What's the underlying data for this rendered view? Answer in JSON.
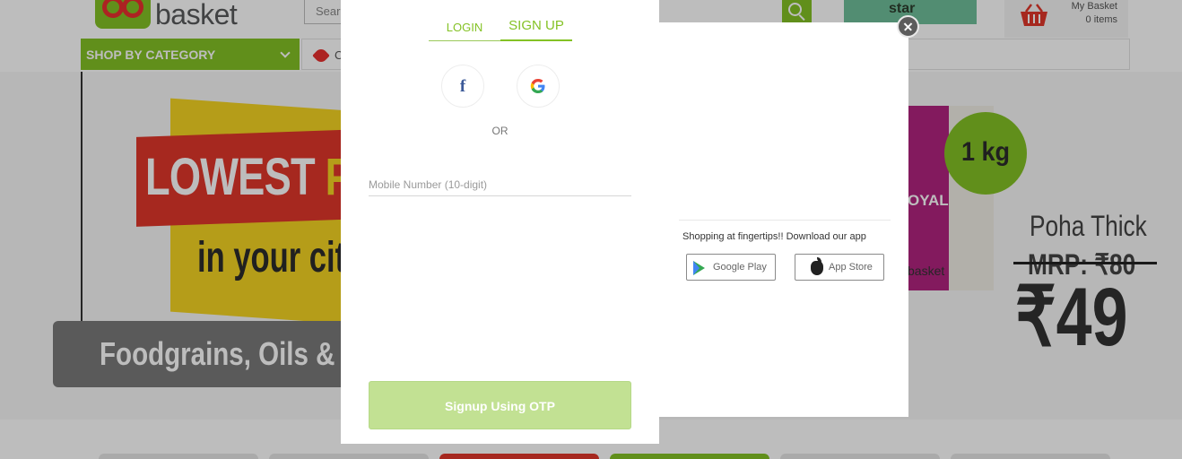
{
  "header": {
    "logo_text": "basket",
    "search_placeholder": "Sear",
    "bbstar_label": "star",
    "basket_title": "My Basket",
    "basket_count": "0 items"
  },
  "nav": {
    "shop_by_category": "SHOP BY CATEGORY",
    "offers_fragment": "C"
  },
  "hero": {
    "headline_a": "LOWEST ",
    "headline_b": "PR",
    "subline": "in your cit",
    "category_pill": "Foodgrains, Oils &"
  },
  "promo": {
    "weight_badge": "1 kg",
    "product_name": "Poha Thick",
    "mrp": "MRP: ₹80",
    "price": "₹49",
    "pack_brand": "OYAL",
    "pack_footer": "basket"
  },
  "modal": {
    "tabs": {
      "login": "LOGIN",
      "signup": "SIGN UP"
    },
    "social": {
      "facebook": "f",
      "google": "G"
    },
    "or_label": "OR",
    "mobile_placeholder": "Mobile Number (10-digit)",
    "otp_button": "Signup Using OTP",
    "app_promo_text": "Shopping at fingertips!! Download our app",
    "google_play": "Google Play",
    "app_store": "App Store"
  },
  "colors": {
    "brand_green": "#84c225",
    "otp_button_disabled": "#c2e193",
    "overlay": "rgba(0,0,0,0.26)"
  }
}
